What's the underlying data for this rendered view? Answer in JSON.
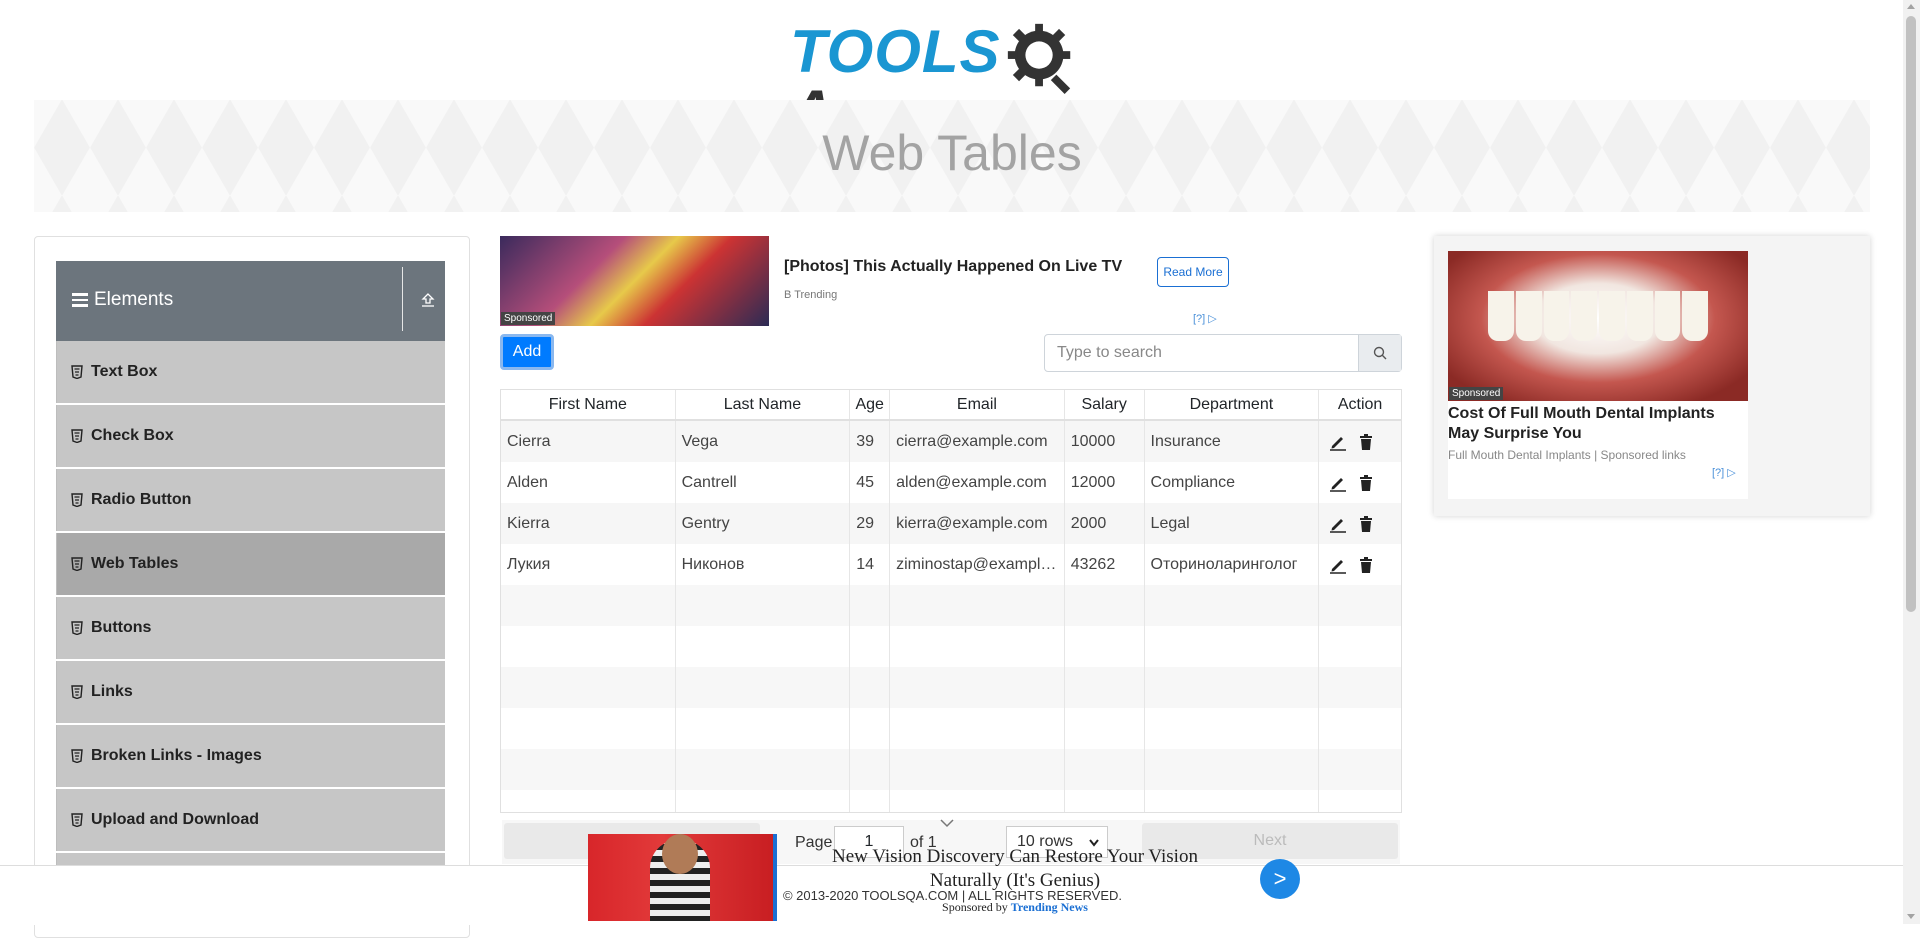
{
  "logo": {
    "text_tools": "TOOLS",
    "text_qa": "A",
    "brand_color": "#1a96d2"
  },
  "banner": {
    "title": "Web Tables"
  },
  "sidebar": {
    "group_title": "Elements",
    "items": [
      {
        "label": "Text Box"
      },
      {
        "label": "Check Box"
      },
      {
        "label": "Radio Button"
      },
      {
        "label": "Web Tables",
        "active": true
      },
      {
        "label": "Buttons"
      },
      {
        "label": "Links"
      },
      {
        "label": "Broken Links - Images"
      },
      {
        "label": "Upload and Download"
      }
    ]
  },
  "top_ad": {
    "sponsored": "Sponsored",
    "title": "[Photos] This Actually Happened On Live TV",
    "source": "B Trending",
    "read_more": "Read More",
    "adchoice": "[?]"
  },
  "toolbar": {
    "add_label": "Add",
    "search_placeholder": "Type to search",
    "search_icon": "search-icon"
  },
  "table": {
    "headers": [
      "First Name",
      "Last Name",
      "Age",
      "Email",
      "Salary",
      "Department",
      "Action"
    ],
    "rows": [
      [
        "Cierra",
        "Vega",
        "39",
        "cierra@example.com",
        "10000",
        "Insurance"
      ],
      [
        "Alden",
        "Cantrell",
        "45",
        "alden@example.com",
        "12000",
        "Compliance"
      ],
      [
        "Kierra",
        "Gentry",
        "29",
        "kierra@example.com",
        "2000",
        "Legal"
      ],
      [
        "Лукия",
        "Никонов",
        "14",
        "ziminostap@example.com",
        "43262",
        "Оториноларинголог"
      ]
    ],
    "action_icons": [
      "pencil-icon",
      "trash-icon"
    ]
  },
  "pagination": {
    "page_label": "Page",
    "page_value": "1",
    "of_label": "of 1",
    "rows_option": "10 rows",
    "next_label": "Next"
  },
  "right_ad": {
    "sponsored": "Sponsored",
    "title": "Cost Of Full Mouth Dental Implants May Surprise You",
    "source": "Full Mouth Dental Implants | Sponsored links",
    "adchoice": "[?]"
  },
  "footer": {
    "copyright": "© 2013-2020 TOOLSQA.COM | ALL RIGHTS RESERVED."
  },
  "bottom_ad": {
    "title": "New Vision Discovery Can Restore Your Vision Naturally (It's Genius)",
    "sponsored_by": "Sponsored by",
    "sponsor_name": "Trending News",
    "go": ">"
  }
}
